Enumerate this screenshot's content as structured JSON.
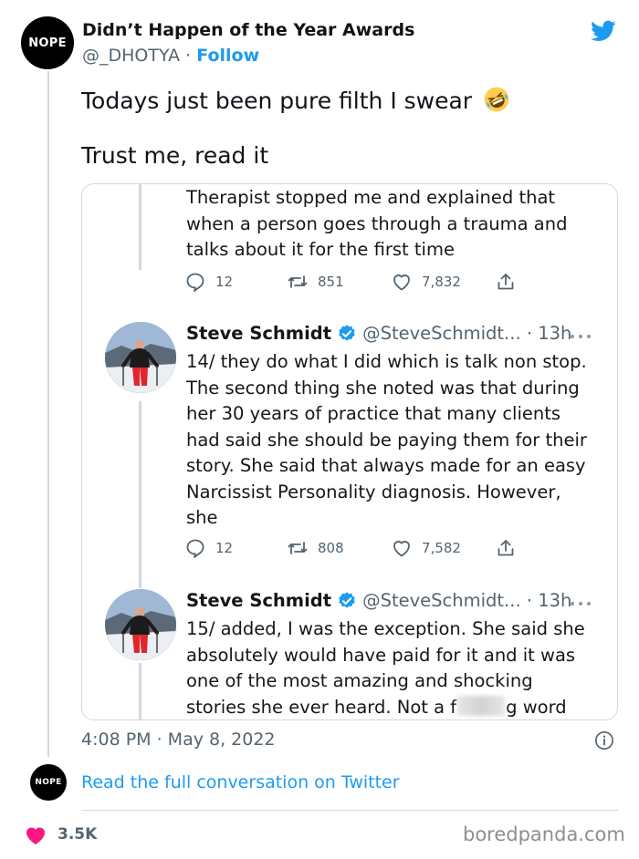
{
  "tweet": {
    "avatar_text": "NOPE",
    "author_name": "Didn’t Happen of the Year Awards",
    "handle": "@_DHOTYA",
    "separator": "·",
    "follow_label": "Follow",
    "text_line1": "Todays just been pure filth I swear",
    "emoji": "rolling-on-floor-laughing-emoji",
    "text_line2": "Trust me, read it",
    "timestamp": "4:08 PM · May 8, 2022",
    "read_full": "Read the full conversation on Twitter",
    "likes": "3.5K",
    "reply_avatar_text": "NOPE"
  },
  "screenshot": {
    "top_lines": [
      "Therapist stopped me and explained that",
      "when a person goes through a trauma and",
      "talks about it for the first time"
    ],
    "actions1": {
      "replies": "12",
      "retweets": "851",
      "likes": "7,832"
    },
    "post2": {
      "name": "Steve Schmidt",
      "handle": "@SteveSchmidt... · 13h",
      "lines": [
        "14/ they do what I did which is  talk non stop.",
        "The second thing she noted was that during",
        "her 30 years of practice that many clients",
        "had said she should be paying them for their",
        "story. She said that always made for an easy",
        "Narcissist Personality diagnosis. However,",
        "she"
      ]
    },
    "actions2": {
      "replies": "12",
      "retweets": "808",
      "likes": "7,582"
    },
    "post3": {
      "name": "Steve Schmidt",
      "handle": "@SteveSchmidt... · 13h",
      "lines": [
        "15/ added, I was the exception. She said she",
        "absolutely would have paid for it and it was",
        "one of the most amazing and shocking"
      ],
      "last_line_start": "stories she ever heard. Not a f",
      "last_line_end": "g word"
    }
  },
  "watermark": "boredpanda.com",
  "colors": {
    "twitter_blue": "#1d9bf0",
    "heart_pink": "#f91880",
    "muted_gray": "#536471",
    "border": "#cfd9de"
  },
  "icons": [
    "twitter-bird-icon",
    "emoji-icon",
    "reply-icon",
    "retweet-icon",
    "like-icon",
    "share-icon",
    "verified-icon",
    "more-icon",
    "info-icon",
    "heart-icon"
  ]
}
